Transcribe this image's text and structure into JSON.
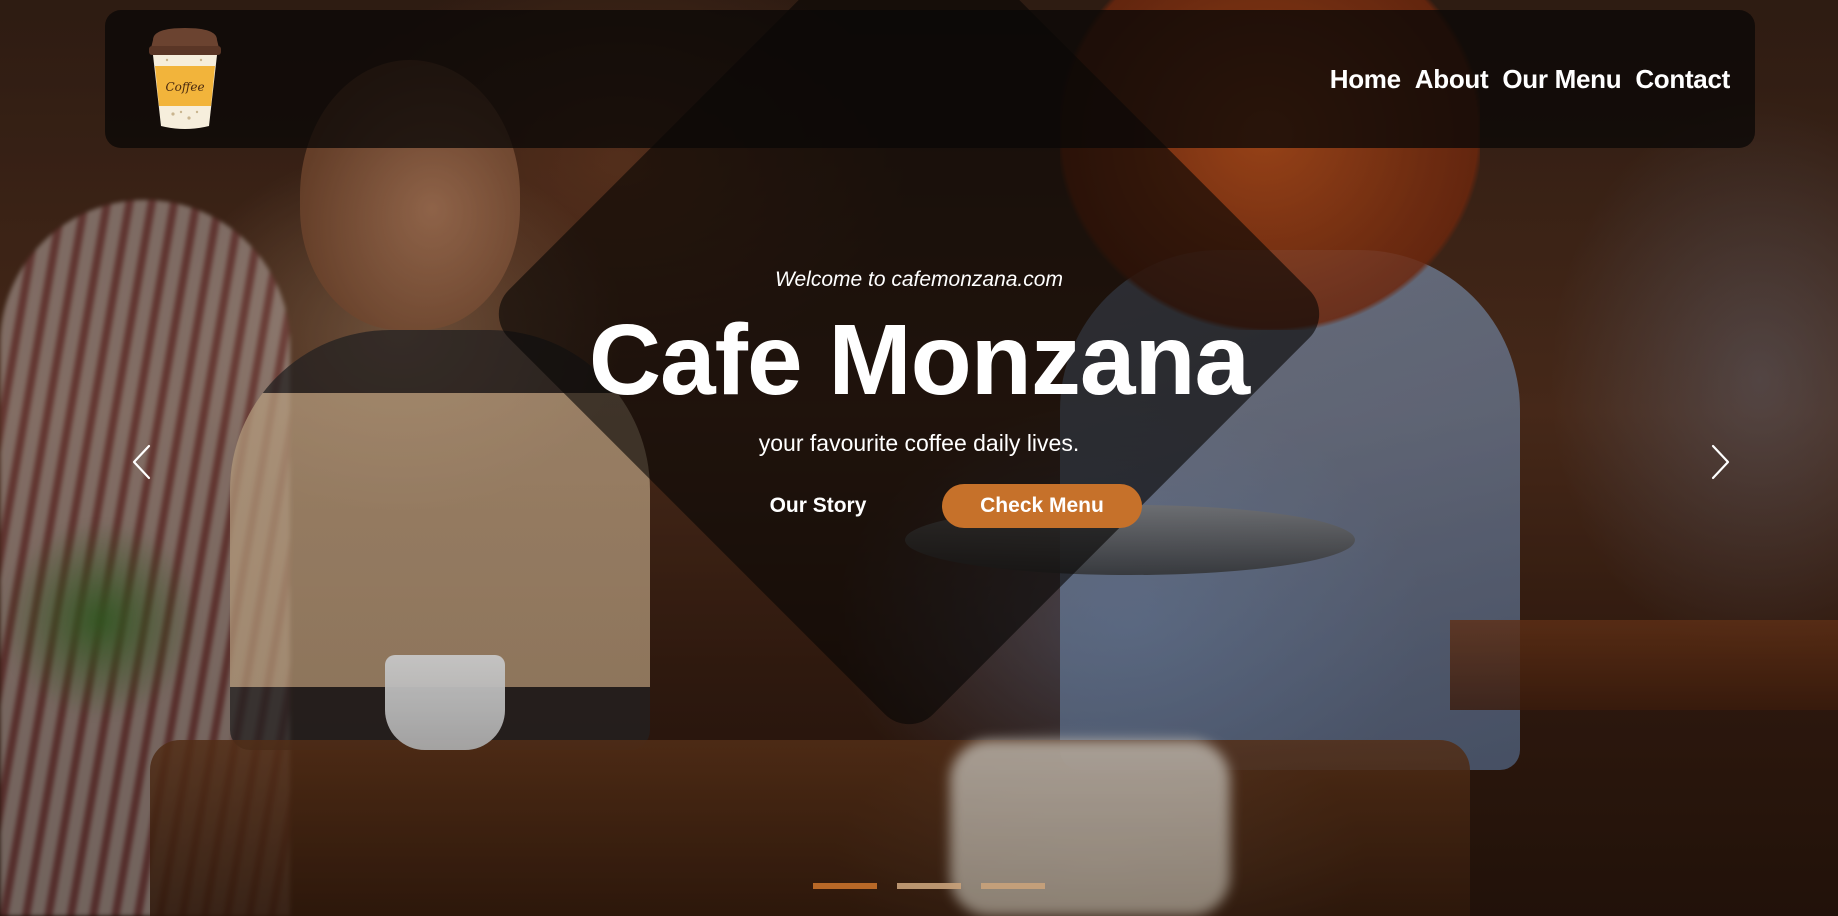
{
  "logo": {
    "text": "Coffee",
    "icon": "coffee-cup-icon"
  },
  "nav": {
    "items": [
      {
        "label": "Home"
      },
      {
        "label": "About"
      },
      {
        "label": "Our Menu"
      },
      {
        "label": "Contact"
      }
    ]
  },
  "hero": {
    "welcome": "Welcome to cafemonzana.com",
    "title": "Cafe Monzana",
    "subtitle": "your favourite coffee daily lives.",
    "primary_button": "Our Story",
    "secondary_button": "Check Menu"
  },
  "carousel": {
    "prev_icon": "chevron-left-icon",
    "next_icon": "chevron-right-icon",
    "slide_count": 3,
    "active_index": 0
  },
  "colors": {
    "accent": "#c6712a",
    "overlay": "#080605",
    "indicator_inactive": "#c9a27a"
  }
}
